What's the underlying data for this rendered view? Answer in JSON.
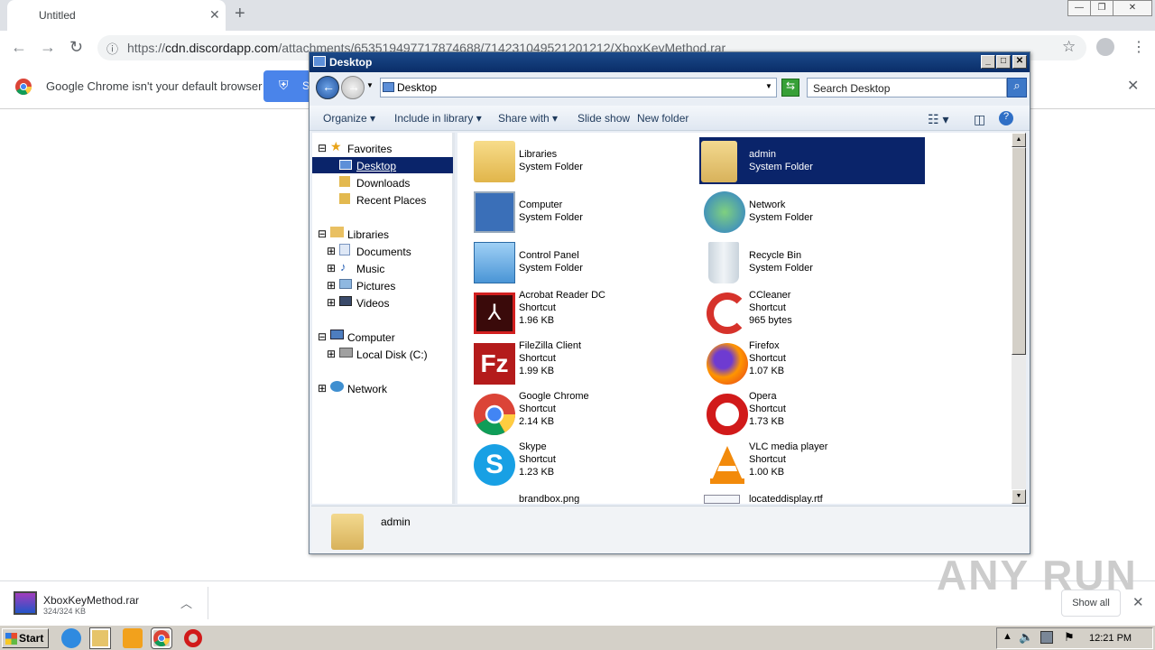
{
  "chrome": {
    "tab_title": "Untitled",
    "url_prefix": "https://",
    "url_domain": "cdn.discordapp.com",
    "url_path": "/attachments/653519497717874688/714231049521201212/XboxKeyMethod.rar",
    "infobar_text": "Google Chrome isn't your default browser",
    "set_default_partial": "S"
  },
  "explorer": {
    "title": "Desktop",
    "address": "Desktop",
    "search_placeholder": "Search Desktop",
    "commands": [
      "Organize",
      "Include in library",
      "Share with",
      "Slide show",
      "New folder"
    ],
    "nav": {
      "favorites": "Favorites",
      "desktop": "Desktop",
      "downloads": "Downloads",
      "recent": "Recent Places",
      "libraries": "Libraries",
      "documents": "Documents",
      "music": "Music",
      "pictures": "Pictures",
      "videos": "Videos",
      "computer": "Computer",
      "localdisk": "Local Disk (C:)",
      "network": "Network"
    },
    "items": [
      {
        "name": "Libraries",
        "type": "System Folder",
        "size": ""
      },
      {
        "name": "admin",
        "type": "System Folder",
        "size": ""
      },
      {
        "name": "Computer",
        "type": "System Folder",
        "size": ""
      },
      {
        "name": "Network",
        "type": "System Folder",
        "size": ""
      },
      {
        "name": "Control Panel",
        "type": "System Folder",
        "size": ""
      },
      {
        "name": "Recycle Bin",
        "type": "System Folder",
        "size": ""
      },
      {
        "name": "Acrobat Reader DC",
        "type": "Shortcut",
        "size": "1.96 KB"
      },
      {
        "name": "CCleaner",
        "type": "Shortcut",
        "size": "965 bytes"
      },
      {
        "name": "FileZilla Client",
        "type": "Shortcut",
        "size": "1.99 KB"
      },
      {
        "name": "Firefox",
        "type": "Shortcut",
        "size": "1.07 KB"
      },
      {
        "name": "Google Chrome",
        "type": "Shortcut",
        "size": "2.14 KB"
      },
      {
        "name": "Opera",
        "type": "Shortcut",
        "size": "1.73 KB"
      },
      {
        "name": "Skype",
        "type": "Shortcut",
        "size": "1.23 KB"
      },
      {
        "name": "VLC media player",
        "type": "Shortcut",
        "size": "1.00 KB"
      },
      {
        "name": "brandbox.png",
        "type": "",
        "size": ""
      },
      {
        "name": "locateddisplay.rtf",
        "type": "",
        "size": ""
      }
    ],
    "details_name": "admin"
  },
  "download": {
    "name": "XboxKeyMethod.rar",
    "size": "324/324 KB",
    "show_all": "Show all"
  },
  "watermark": "ANY RUN",
  "taskbar": {
    "start": "Start",
    "clock": "12:21 PM"
  }
}
